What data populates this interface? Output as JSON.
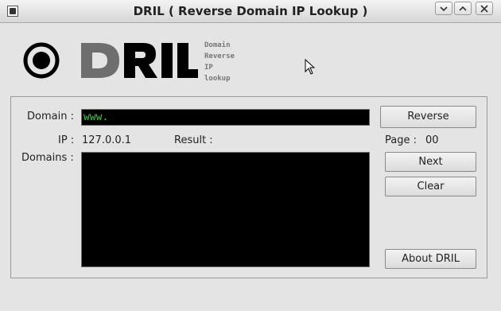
{
  "window": {
    "title": "DRIL ( Reverse Domain IP Lookup )",
    "controls": [
      "minimize-icon",
      "maximize-icon",
      "close-icon"
    ]
  },
  "logo": {
    "name": "DRIL",
    "tagline": [
      "Domain",
      "Reverse",
      "IP",
      "lookup"
    ]
  },
  "form": {
    "domain_label": "Domain :",
    "domain_value": "www.",
    "ip_label": "IP :",
    "ip_value": "127.0.0.1",
    "result_label": "Result :",
    "result_value": "",
    "page_label": "Page :",
    "page_value": "00",
    "domains_label": "Domains :"
  },
  "buttons": {
    "reverse": "Reverse",
    "next": "Next",
    "clear": "Clear",
    "about": "About DRIL"
  },
  "colors": {
    "field_bg": "#000000",
    "field_text": "#32d232",
    "logo_gray": "#6e6e6e"
  }
}
